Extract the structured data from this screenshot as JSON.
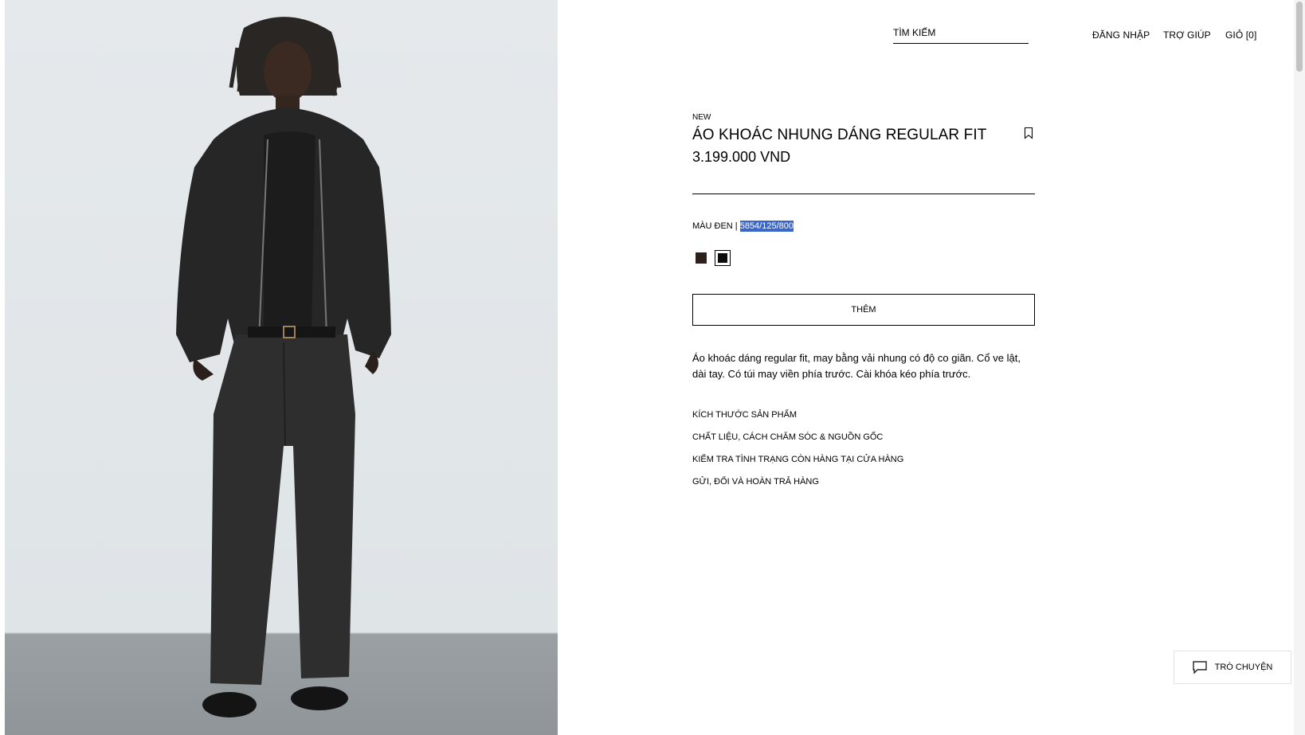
{
  "header": {
    "search_label": "TÌM KIẾM",
    "login": "ĐĂNG NHẬP",
    "help": "TRỢ GIÚP",
    "cart": "GIỎ [0]"
  },
  "product": {
    "badge": "NEW",
    "title": "ÁO KHOÁC NHUNG DÁNG REGULAR FIT",
    "price": "3.199.000 VND",
    "color_label": "MÀU ĐEN |",
    "sku": "5854/125/800",
    "swatches": [
      {
        "color": "#2b201c",
        "selected": false
      },
      {
        "color": "#0d0d0d",
        "selected": true
      }
    ],
    "add_button": "THÊM",
    "description": "Áo khoác dáng regular fit, may bằng vải nhung có độ co giãn. Cổ ve lật, dài tay. Có túi may viền phía trước. Cài khóa kéo phía trước.",
    "accordions": [
      "KÍCH THƯỚC SẢN PHẨM",
      "CHẤT LIỆU, CÁCH CHĂM SÓC & NGUỒN GỐC",
      "KIỂM TRA TÌNH TRẠNG CÒN HÀNG TẠI CỬA HÀNG",
      "GỬI, ĐỔI VÀ HOÀN TRẢ HÀNG"
    ]
  },
  "chat": {
    "label": "TRÒ CHUYỆN",
    "icon": "chat-bubble-icon"
  },
  "icons": {
    "bookmark": "bookmark-icon"
  }
}
